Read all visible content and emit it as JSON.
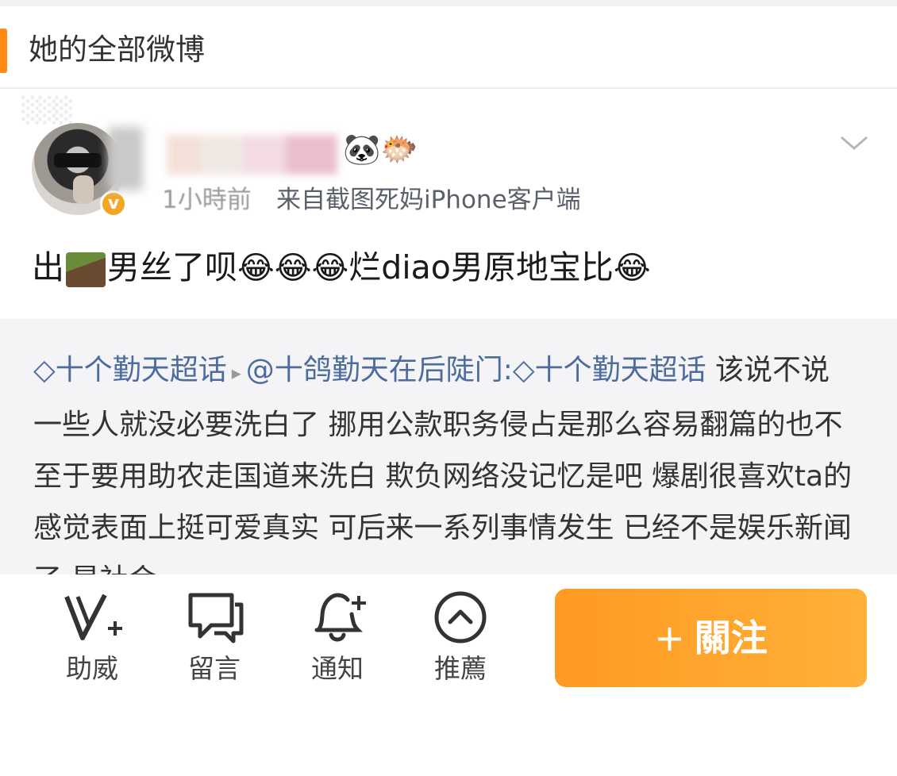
{
  "section": {
    "title": "她的全部微博"
  },
  "post": {
    "badges": "🐼🐡",
    "time": "1小時前",
    "source": "来自截图死妈iPhone客户端",
    "menu_icon": "chevron-down-icon",
    "text_parts": [
      "出",
      "男丝了呗",
      "😂😂😂",
      "烂diao男原地宝比",
      "😂"
    ]
  },
  "repost": {
    "topic1": "十个勤天超话",
    "user": "@十鸽勤天在后陡门:",
    "topic2": "十个勤天超话",
    "body": "该说不说 一些人就没必要洗白了 挪用公款职务侵占是那么容易翻篇的也不至于要用助农走国道来洗白 欺负网络没记忆是吧 爆剧很喜欢ta的 感觉表面上挺可爱真实 可后来一系列事情发生 已经不是娱乐新闻了 是社会"
  },
  "toolbar": {
    "items": [
      {
        "label": "助威",
        "icon": "v-plus-icon"
      },
      {
        "label": "留言",
        "icon": "comment-icon"
      },
      {
        "label": "通知",
        "icon": "bell-plus-icon"
      },
      {
        "label": "推薦",
        "icon": "chevron-up-circle-icon"
      }
    ],
    "follow_plus": "+",
    "follow_label": "關注"
  },
  "colors": {
    "accent": "#ff8a14",
    "follow_button": "#ffa52b",
    "link": "#4d6b9c",
    "repost_bg": "#f4f4f6"
  }
}
